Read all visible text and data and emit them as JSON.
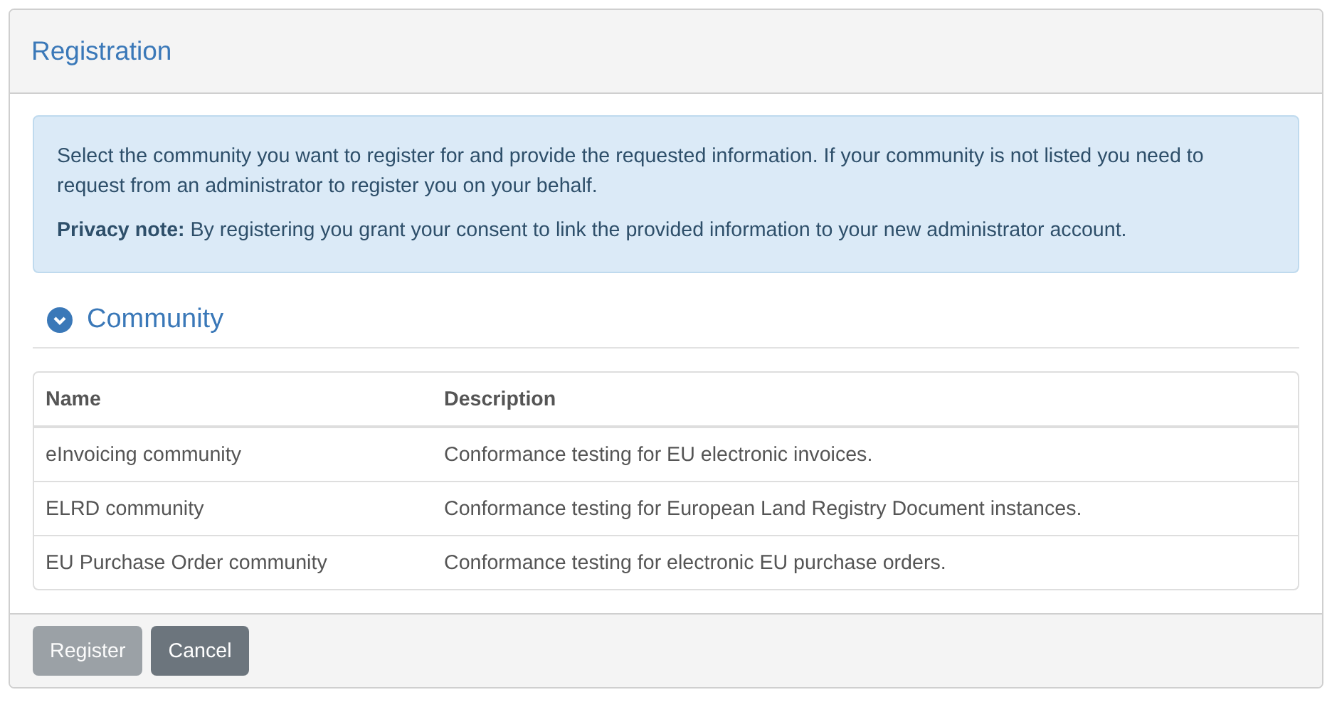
{
  "panel": {
    "title": "Registration"
  },
  "alert": {
    "paragraphs": [
      "Select the community you want to register for and provide the requested information. If your community is not listed you need to request from an administrator to register you on your behalf.",
      "**Privacy note:** By registering you grant your consent to link the provided information to your new administrator account."
    ]
  },
  "section": {
    "title": "Community",
    "expanded": true
  },
  "table": {
    "columns": [
      "Name",
      "Description"
    ],
    "rows": [
      [
        "eInvoicing community",
        "Conformance testing for EU electronic invoices."
      ],
      [
        "ELRD community",
        "Conformance testing for European Land Registry Document instances."
      ],
      [
        "EU Purchase Order community",
        "Conformance testing for electronic EU purchase orders."
      ]
    ]
  },
  "buttons": [
    {
      "label": "Register",
      "disabled": true
    },
    {
      "label": "Cancel",
      "disabled": false
    }
  ]
}
